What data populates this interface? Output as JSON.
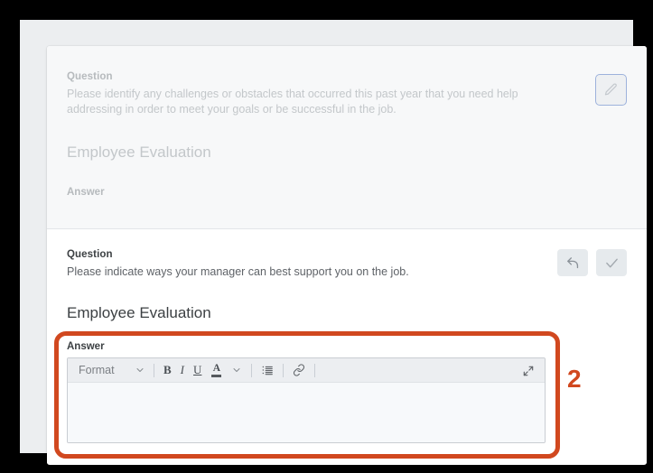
{
  "panels": {
    "readonly": {
      "question_label": "Question",
      "question_text": "Please identify any challenges or obstacles that occurred this past year that you need help addressing in order to meet your goals or be successful in the job.",
      "section_title": "Employee Evaluation",
      "answer_label": "Answer",
      "edit_button": {
        "icon": "pencil-icon",
        "border_color": "#9db2dc",
        "background": "#eef0f2"
      }
    },
    "active": {
      "question_label": "Question",
      "question_text": "Please indicate ways your manager can best support you on the job.",
      "section_title": "Employee Evaluation",
      "answer_label": "Answer",
      "actions": [
        {
          "name": "undo-button",
          "icon": "undo-arrow-icon"
        },
        {
          "name": "confirm-button",
          "icon": "checkmark-icon"
        }
      ],
      "editor": {
        "format_label": "Format",
        "toolbar": [
          {
            "name": "format-dropdown",
            "label": "Format",
            "icon": "chevron-down-icon"
          },
          {
            "name": "bold-button",
            "label": "B",
            "icon": "bold-icon"
          },
          {
            "name": "italic-button",
            "label": "I",
            "icon": "italic-icon"
          },
          {
            "name": "underline-button",
            "label": "U",
            "icon": "underline-icon"
          },
          {
            "name": "text-color-button",
            "label": "A",
            "icon": "text-color-icon"
          },
          {
            "name": "text-color-dropdown",
            "label": "",
            "icon": "chevron-down-icon"
          },
          {
            "name": "bullet-list-button",
            "label": "",
            "icon": "bullet-list-icon"
          },
          {
            "name": "link-button",
            "label": "",
            "icon": "link-icon"
          },
          {
            "name": "expand-button",
            "label": "",
            "icon": "expand-diagonal-icon"
          }
        ],
        "content": ""
      }
    }
  },
  "annotation": {
    "number": "2",
    "color": "#d1481f"
  }
}
